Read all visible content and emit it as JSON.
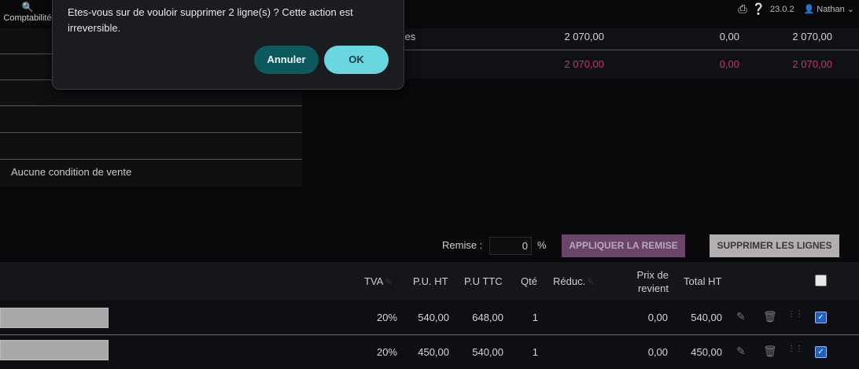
{
  "nav": {
    "comptabilite_label": "Comptabilité",
    "comptabilite_icon": "magnifier-icon"
  },
  "topbar": {
    "version": "23.0.2",
    "user": "Nathan",
    "print_icon": "printer-icon",
    "help_icon": "help-icon",
    "user_icon": "user-icon"
  },
  "left_panel": {
    "condition_text": "Aucune condition de vente"
  },
  "totals": {
    "row1": {
      "label": "ces",
      "ht": "2 070,00",
      "tva": "0,00",
      "ttc": "2 070,00"
    },
    "row2": {
      "ht": "2 070,00",
      "tva": "0,00",
      "ttc": "2 070,00"
    }
  },
  "remise": {
    "label": "Remise :",
    "value": "0",
    "unit": "%",
    "apply_label": "APPLIQUER LA REMISE",
    "delete_label": "SUPPRIMER LES LIGNES"
  },
  "table": {
    "headers": {
      "tva": "TVA",
      "pu_ht": "P.U. HT",
      "pu_ttc": "P.U TTC",
      "qte": "Qté",
      "reduc": "Réduc.",
      "prix_revient": "Prix de revient",
      "total_ht": "Total HT"
    },
    "rows": [
      {
        "tva": "20%",
        "pu_ht": "540,00",
        "pu_ttc": "648,00",
        "qte": "1",
        "prix_revient": "0,00",
        "total_ht": "540,00",
        "checked": true
      },
      {
        "tva": "20%",
        "pu_ht": "450,00",
        "pu_ttc": "540,00",
        "qte": "1",
        "prix_revient": "0,00",
        "total_ht": "450,00",
        "checked": true
      }
    ]
  },
  "dialog": {
    "message": "Etes-vous sur de vouloir supprimer 2 ligne(s) ? Cette action est irreversible.",
    "cancel_label": "Annuler",
    "ok_label": "OK"
  },
  "colors": {
    "accent_ok": "#6ad7e0",
    "accent_cancel": "#0c5a5e",
    "amount_pink": "#c9355f"
  }
}
